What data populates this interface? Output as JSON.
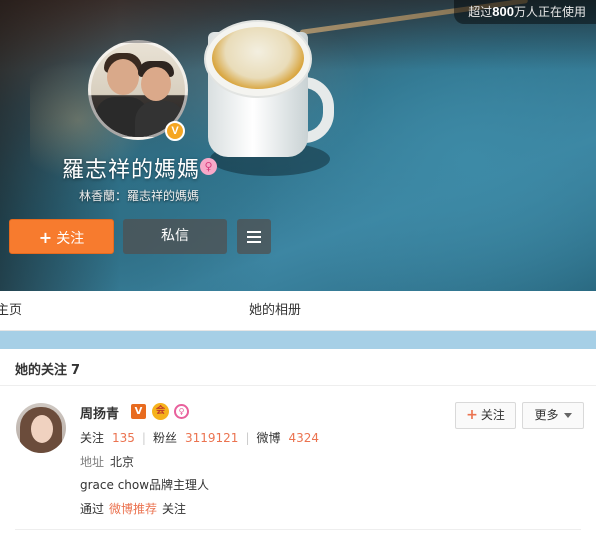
{
  "cover": {
    "user_count_prefix": "超过",
    "user_count_num": "800",
    "user_count_suffix": "万人正在使用",
    "profile_name": "羅志祥的媽媽",
    "verified_badge": "V",
    "gender_icon": "female-icon",
    "description": "林香蘭：羅志祥的媽媽",
    "follow_button": "关注",
    "message_button": "私信",
    "menu_icon": "hamburger-icon"
  },
  "tabs": {
    "home": "主页",
    "album": "她的相册"
  },
  "following": {
    "title": "她的关注",
    "count": "7",
    "items": [
      {
        "name": "周扬青",
        "vip_badge": "V",
        "member_badge": "会",
        "follow_label": "关注",
        "stat_following_label": "关注",
        "stat_following": "135",
        "stat_fans_label": "粉丝",
        "stat_fans": "3119121",
        "stat_weibo_label": "微博",
        "stat_weibo": "4324",
        "location_label": "地址",
        "location": "北京",
        "bio": "grace chow品牌主理人",
        "via_prefix": "通过",
        "via_link": "微博推荐",
        "via_suffix": "关注",
        "follow_button": "关注",
        "more_button": "更多"
      }
    ]
  },
  "colors": {
    "accent_orange": "#f77b2e",
    "link_orange": "#eb7350",
    "strip_blue": "#a6cfe6"
  }
}
